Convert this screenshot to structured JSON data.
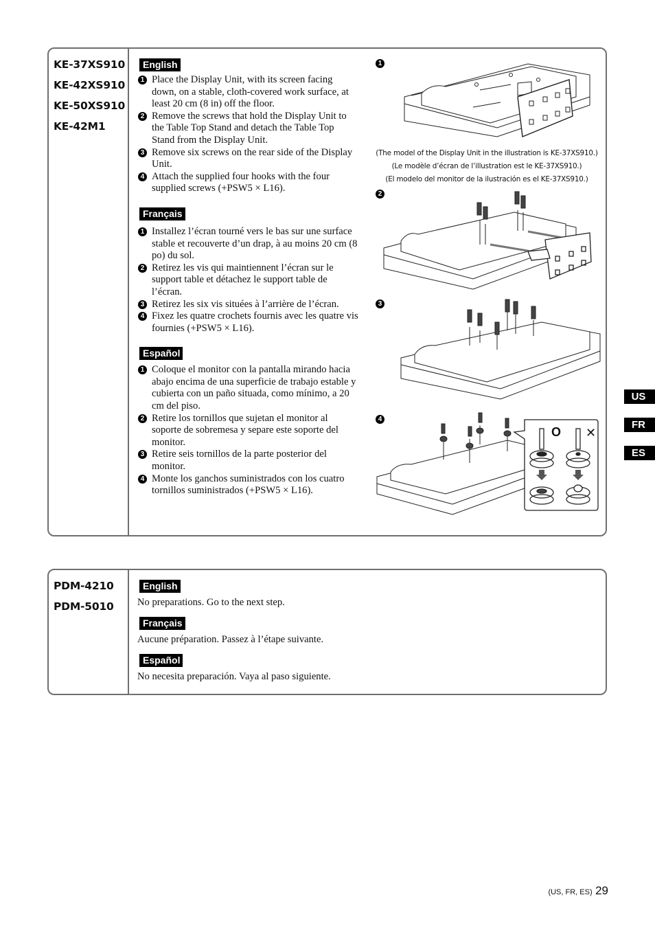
{
  "section_1": {
    "models": [
      "KE-37XS910",
      "KE-42XS910",
      "KE-50XS910",
      "KE-42M1"
    ],
    "english": {
      "label": "English",
      "steps": [
        {
          "num": "1",
          "text": "Place the Display Unit, with its screen facing down, on a stable, cloth-covered work surface, at least 20 cm (8 in) off the floor."
        },
        {
          "num": "2",
          "text": "Remove the screws that hold the Display Unit to the Table Top Stand and detach the Table Top Stand from the Display Unit."
        },
        {
          "num": "3",
          "text": "Remove six screws on the rear side of the Display Unit."
        },
        {
          "num": "4",
          "text": "Attach the supplied four hooks with the four supplied screws (+PSW5 × L16)."
        }
      ]
    },
    "francais": {
      "label": "Français",
      "steps": [
        {
          "num": "1",
          "text": "Installez l’écran tourné vers le bas sur une surface stable et recouverte d’un drap, à au moins 20 cm (8 po) du sol."
        },
        {
          "num": "2",
          "text": "Retirez les vis qui maintiennent l’écran sur le support table et détachez le support table de l’écran."
        },
        {
          "num": "3",
          "text": "Retirez les six vis situées à l’arrière de l’écran."
        },
        {
          "num": "4",
          "text": "Fixez les quatre crochets fournis avec les quatre vis fournies (+PSW5 × L16)."
        }
      ]
    },
    "espanol": {
      "label": "Español",
      "steps": [
        {
          "num": "1",
          "text": "Coloque el monitor con la pantalla mirando hacia abajo encima de una superficie de trabajo estable y cubierta con un paño situada, como mínimo, a 20 cm del piso."
        },
        {
          "num": "2",
          "text": "Retire los tornillos que sujetan el monitor al soporte de sobremesa y separe este soporte del monitor."
        },
        {
          "num": "3",
          "text": "Retire seis tornillos de la parte posterior del monitor."
        },
        {
          "num": "4",
          "text": "Monte los ganchos suministrados con los cuatro tornillos suministrados (+PSW5 × L16)."
        }
      ]
    },
    "figures": {
      "fig1_num": "1",
      "fig2_num": "2",
      "fig3_num": "3",
      "fig4_num": "4",
      "captions": [
        "(The model of the Display Unit in the illustration is KE-37XS910.)",
        "(Le modèle d’écran de l’illustration est le KE-37XS910.)",
        "(El modelo del monitor de la ilustración es el KE-37XS910.)"
      ],
      "correct_mark": "O",
      "wrong_mark": "✕"
    }
  },
  "section_2": {
    "models": [
      "PDM-4210",
      "PDM-5010"
    ],
    "english": {
      "label": "English",
      "text": "No preparations. Go to the next step."
    },
    "francais": {
      "label": "Français",
      "text": "Aucune préparation. Passez à l’étape suivante."
    },
    "espanol": {
      "label": "Español",
      "text": "No necesita preparación. Vaya al paso siguiente."
    }
  },
  "side_tabs": [
    "US",
    "FR",
    "ES"
  ],
  "footer": {
    "langs": "(US, FR, ES)",
    "page": "29"
  }
}
